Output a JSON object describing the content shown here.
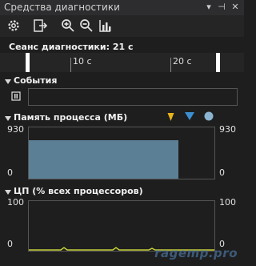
{
  "window": {
    "title": "Средства диагностики",
    "title_buttons": [
      "▾",
      "⊣",
      "✕"
    ]
  },
  "toolbar": {
    "tools": [
      "settings-icon",
      "export-icon",
      "zoom-in-icon",
      "zoom-out-icon",
      "reset-zoom-icon"
    ]
  },
  "session": {
    "label": "Сеанс диагностики: 21 с"
  },
  "ruler": {
    "labels": [
      "10 с",
      "20 с"
    ]
  },
  "events": {
    "title": "События"
  },
  "memory": {
    "title": "Память процесса (МБ)",
    "max_label": "930",
    "min_label": "0",
    "right_max_label": "930",
    "right_min_label": "0",
    "legend_colors": [
      "#e8b31a",
      "#3b8fd1",
      "#8ab4cf"
    ],
    "fill_color": "#5b7f95",
    "value_fraction": 0.75
  },
  "cpu": {
    "title": "ЦП (% всех процессоров)",
    "max_label": "100",
    "min_label": "0",
    "right_max_label": "100",
    "right_min_label": "0",
    "line_color": "#c8d23a"
  },
  "watermark": "ragemp.pro"
}
